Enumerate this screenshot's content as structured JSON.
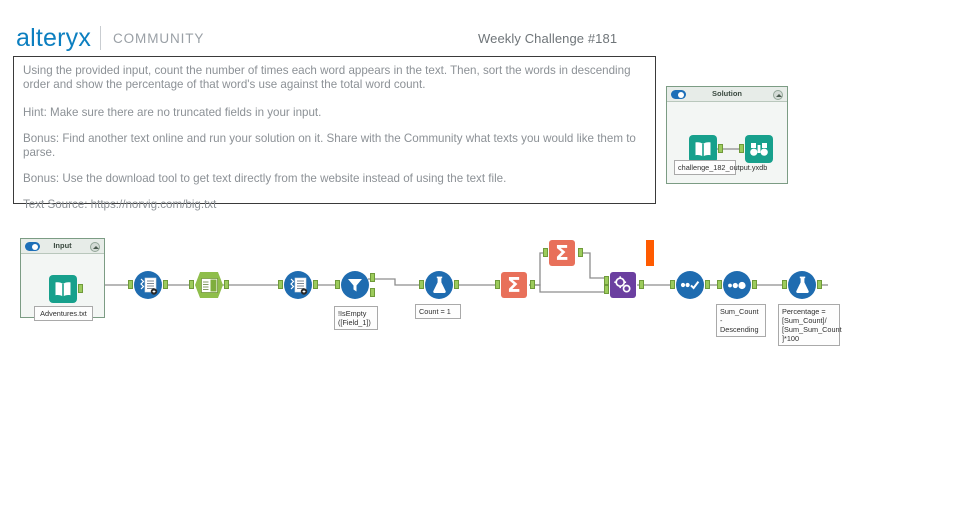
{
  "header": {
    "logo_text": "alteryx",
    "divider": "|",
    "section_label": "COMMUNITY",
    "title": "Weekly Challenge #181"
  },
  "description": {
    "lines": [
      "Using the provided input, count the number of times each word appears in the text.  Then, sort the words in descending order and show the percentage of that word's use against the total word count.",
      "Hint: Make sure there are no truncated fields in your input.",
      "Bonus: Find another text online and run your solution on it. Share with the Community what texts you would like them to parse.",
      "Bonus: Use the download tool to get text directly from the website instead of using the text file.",
      "Text Source: https://norvig.com/big.txt"
    ]
  },
  "solution_container": {
    "title": "Solution",
    "toggle_state": "on",
    "collapse_icon": "chevron-up-icon",
    "tools": [
      {
        "id": "sol-input",
        "type": "input-data-tool",
        "icon": "book-icon",
        "color": "#17a08c"
      },
      {
        "id": "sol-browse",
        "type": "browse-tool",
        "icon": "binoculars-icon",
        "color": "#17a08c"
      }
    ],
    "annotation": "challenge_182_output.yxdb"
  },
  "input_container": {
    "title": "Input",
    "toggle_state": "on",
    "collapse_icon": "chevron-up-icon",
    "tools": [
      {
        "id": "in-input",
        "type": "input-data-tool",
        "icon": "book-icon",
        "color": "#17a08c"
      }
    ],
    "annotation": "Adventures.txt"
  },
  "workflow": {
    "tools": [
      {
        "id": "t1",
        "type": "text-to-columns-tool",
        "icon": "text-to-columns-icon",
        "color": "#1f6cb0",
        "label": ""
      },
      {
        "id": "t2",
        "type": "select-tool",
        "icon": "select-icon",
        "color": "#8fbe4b",
        "label": ""
      },
      {
        "id": "t3",
        "type": "text-to-columns-tool",
        "icon": "text-to-columns-icon",
        "color": "#1f6cb0",
        "label": ""
      },
      {
        "id": "t4",
        "type": "filter-tool",
        "icon": "filter-funnel-icon",
        "color": "#1f6cb0",
        "label": "!IsEmpty\n([Field_1])"
      },
      {
        "id": "t5",
        "type": "formula-tool",
        "icon": "flask-icon",
        "color": "#1f6cb0",
        "label": "Count = 1"
      },
      {
        "id": "t6",
        "type": "summarize-tool",
        "icon": "sigma-icon",
        "color": "#e8705a",
        "label": ""
      },
      {
        "id": "t7",
        "type": "summarize-tool",
        "icon": "sigma-icon",
        "color": "#e8705a",
        "label": ""
      },
      {
        "id": "t8",
        "type": "append-fields-tool",
        "icon": "gears-icon",
        "color": "#6b3fa0",
        "label": ""
      },
      {
        "id": "t9",
        "type": "unique-tool",
        "icon": "check-dots-icon",
        "color": "#1f6cb0",
        "label": ""
      },
      {
        "id": "t10",
        "type": "sort-tool",
        "icon": "sort-dots-icon",
        "color": "#1f6cb0",
        "label": "Sum_Count -\nDescending"
      },
      {
        "id": "t11",
        "type": "formula-tool",
        "icon": "flask-icon",
        "color": "#1f6cb0",
        "label": "Percentage =\n[Sum_Count]/\n[Sum_Sum_Count\n]*100"
      }
    ],
    "marker": {
      "id": "orange-marker",
      "type": "highlight-marker",
      "color": "#ff5b00"
    }
  },
  "colors": {
    "brand_blue": "#0c7fc0",
    "muted_text": "#8c9196",
    "tool_blue": "#1f6cb0",
    "tool_teal": "#17a08c",
    "tool_green": "#8fbe4b",
    "tool_orange": "#e8705a",
    "tool_purple": "#6b3fa0",
    "marker_orange": "#ff5b00"
  }
}
